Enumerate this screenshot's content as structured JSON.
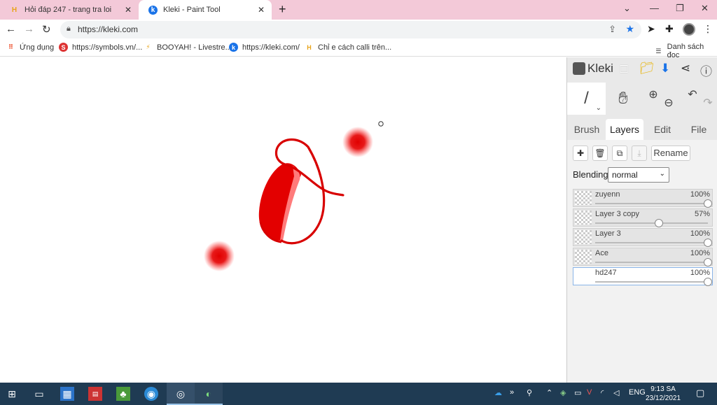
{
  "browser": {
    "tabs": [
      {
        "title": "Hỏi đáp 247 - trang tra loi",
        "favicon": "hd247-favicon",
        "active": false
      },
      {
        "title": "Kleki - Paint Tool",
        "favicon": "kleki-favicon",
        "active": true
      }
    ],
    "url": "https://kleki.com",
    "bookmarks": [
      {
        "label": "Ứng dụng"
      },
      {
        "label": "https://symbols.vn/..."
      },
      {
        "label": "BOOYAH! - Livestre..."
      },
      {
        "label": "https://kleki.com/"
      },
      {
        "label": "Chỉ e cách calli trên..."
      }
    ],
    "reading_list": "Danh sách đọc"
  },
  "kleki": {
    "logo": "Kleki",
    "tabs": [
      "Brush",
      "Layers",
      "Edit",
      "File"
    ],
    "active_tab": "Layers",
    "rename_label": "Rename",
    "blending_label": "Blending",
    "blending_value": "normal",
    "layers": [
      {
        "name": "zuyenn",
        "opacity": "100%",
        "value": 1.0,
        "selected": false
      },
      {
        "name": "Layer 3 copy",
        "opacity": "57%",
        "value": 0.57,
        "selected": false
      },
      {
        "name": "Layer 3",
        "opacity": "100%",
        "value": 1.0,
        "selected": false
      },
      {
        "name": "Ace",
        "opacity": "100%",
        "value": 1.0,
        "selected": false
      },
      {
        "name": "hd247",
        "opacity": "100%",
        "value": 1.0,
        "selected": true
      }
    ],
    "colors": {
      "stroke": "#d80000",
      "accent": "#1a73e8"
    }
  },
  "taskbar": {
    "time": "9:13 SA",
    "date": "23/12/2021",
    "lang": "ENG"
  }
}
